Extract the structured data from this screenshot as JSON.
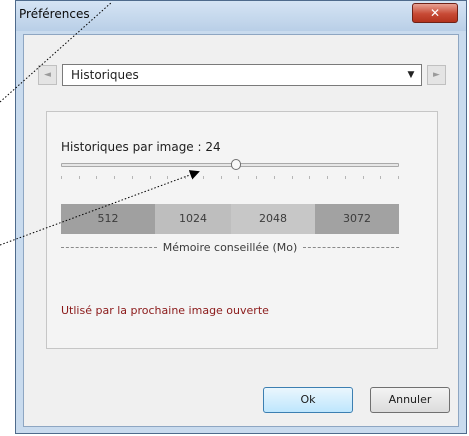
{
  "window": {
    "title": "Préférences",
    "close_glyph": "✕"
  },
  "nav": {
    "prev_glyph": "◄",
    "next_glyph": "►"
  },
  "combo": {
    "value": "Historiques",
    "arrow_glyph": "▼"
  },
  "history": {
    "label": "Historiques par image : 24",
    "value": 24
  },
  "memory": {
    "options": [
      "512",
      "1024",
      "2048",
      "3072"
    ],
    "caption": "Mémoire conseillée (Mo)"
  },
  "info": {
    "text": "Utlisé par la prochaine image ouverte"
  },
  "buttons": {
    "ok": "Ok",
    "cancel": "Annuler"
  },
  "colors": {
    "accent": "#3c7fb1",
    "info_text": "#8b1a1a",
    "close": "#c74a35"
  },
  "icons": {
    "close": "close-icon",
    "combo": "chevron-down-icon",
    "prev": "arrow-left-icon",
    "next": "arrow-right-icon"
  }
}
